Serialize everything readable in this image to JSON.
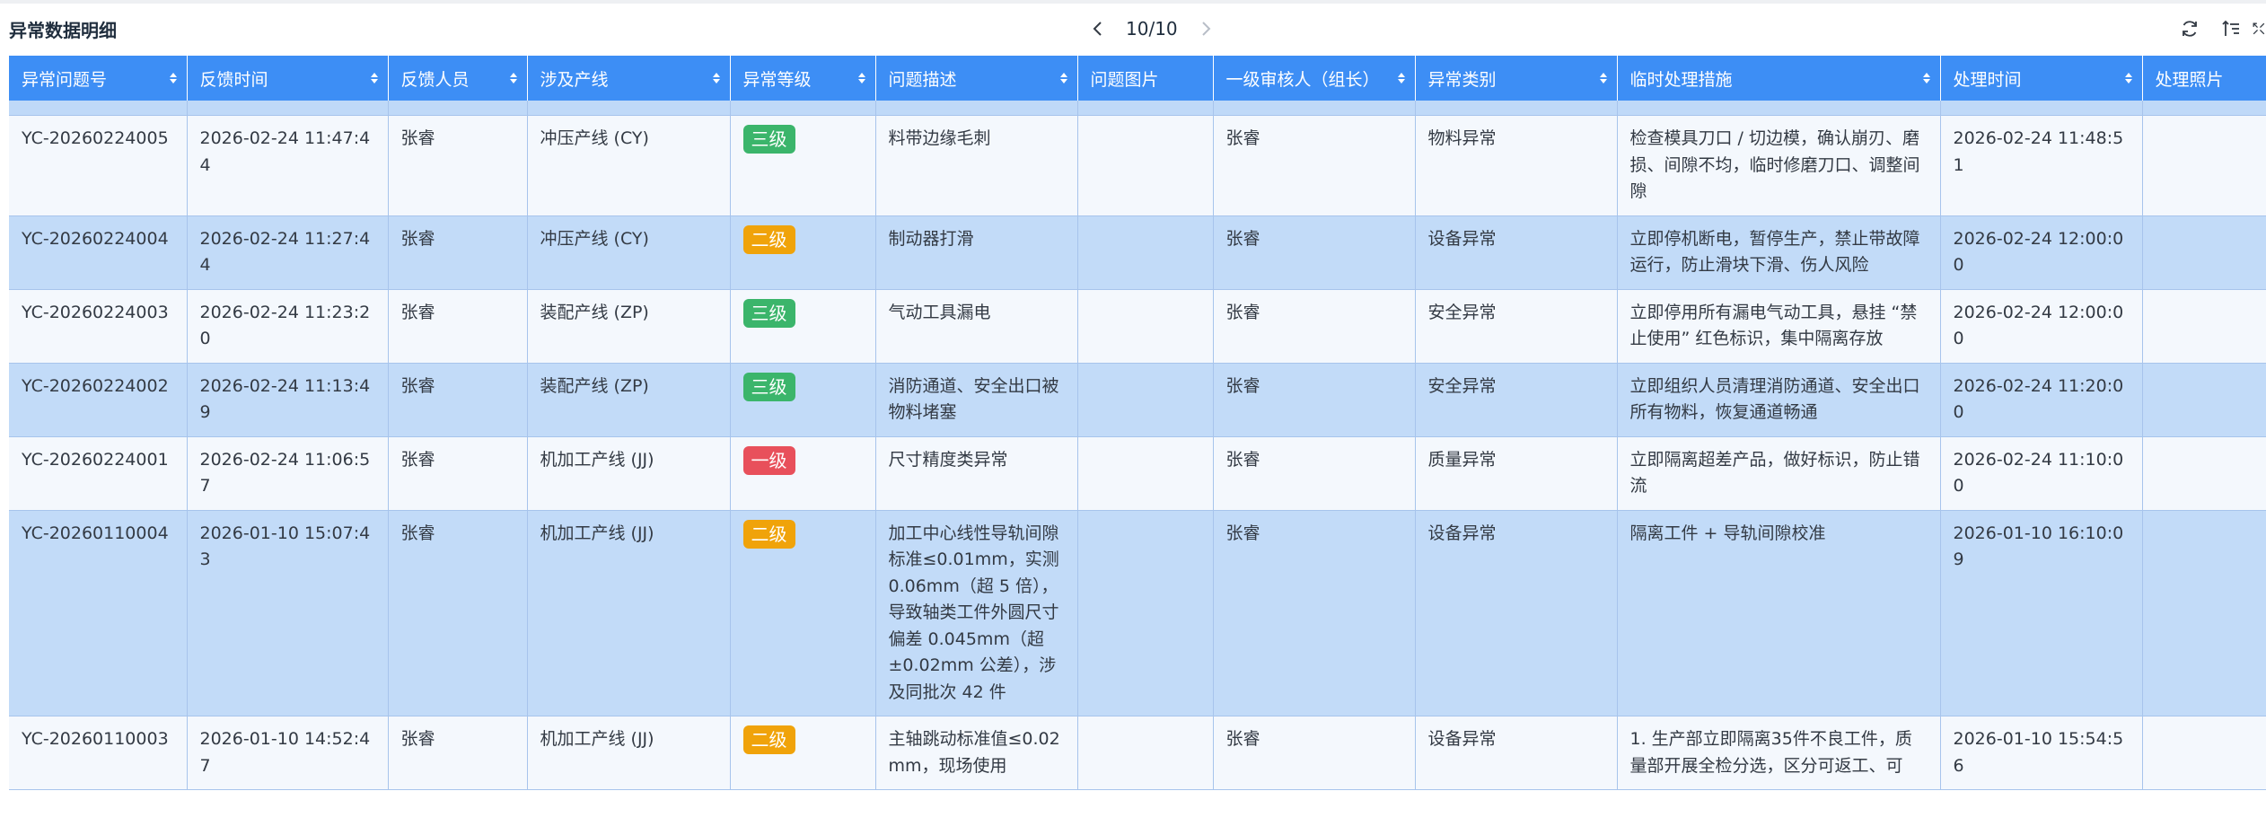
{
  "header": {
    "title": "异常数据明细",
    "pager_text": "10/10",
    "prev_icon": "chevron-left-icon",
    "next_icon": "chevron-right-icon",
    "tools": [
      "refresh-icon",
      "column-settings-icon",
      "fullscreen-icon"
    ]
  },
  "table": {
    "columns": [
      "异常问题号",
      "反馈时间",
      "反馈人员",
      "涉及产线",
      "异常等级",
      "问题描述",
      "问题图片",
      "一级审核人（组长）",
      "异常类别",
      "临时处理措施",
      "处理时间",
      "处理照片"
    ],
    "level_colors": {
      "三级": "#3bb56b",
      "二级": "#f0a30a",
      "一级": "#e8505b"
    },
    "rows": [
      {
        "id": "YC-20260224005",
        "time": "2026-02-24 11:47:44",
        "reporter": "张睿",
        "line": "冲压产线 (CY)",
        "level": "三级",
        "desc": "料带边缘毛刺",
        "image": "",
        "auditor": "张睿",
        "category": "物料异常",
        "measure": "检查模具刀口 / 切边模，确认崩刃、磨损、间隙不均，临时修磨刀口、调整间隙",
        "handle_time": "2026-02-24 11:48:51",
        "photo": ""
      },
      {
        "id": "YC-20260224004",
        "time": "2026-02-24 11:27:44",
        "reporter": "张睿",
        "line": "冲压产线 (CY)",
        "level": "二级",
        "desc": "制动器打滑",
        "image": "",
        "auditor": "张睿",
        "category": "设备异常",
        "measure": "立即停机断电，暂停生产，禁止带故障运行，防止滑块下滑、伤人风险",
        "handle_time": "2026-02-24 12:00:00",
        "photo": ""
      },
      {
        "id": "YC-20260224003",
        "time": "2026-02-24 11:23:20",
        "reporter": "张睿",
        "line": "装配产线 (ZP)",
        "level": "三级",
        "desc": "气动工具漏电",
        "image": "",
        "auditor": "张睿",
        "category": "安全异常",
        "measure": "立即停用所有漏电气动工具，悬挂 “禁止使用” 红色标识，集中隔离存放",
        "handle_time": "2026-02-24 12:00:00",
        "photo": ""
      },
      {
        "id": "YC-20260224002",
        "time": "2026-02-24 11:13:49",
        "reporter": "张睿",
        "line": "装配产线 (ZP)",
        "level": "三级",
        "desc": "消防通道、安全出口被物料堵塞",
        "image": "",
        "auditor": "张睿",
        "category": "安全异常",
        "measure": "立即组织人员清理消防通道、安全出口所有物料，恢复通道畅通",
        "handle_time": "2026-02-24 11:20:00",
        "photo": ""
      },
      {
        "id": "YC-20260224001",
        "time": "2026-02-24 11:06:57",
        "reporter": "张睿",
        "line": "机加工产线 (JJ)",
        "level": "一级",
        "desc": "尺寸精度类异常",
        "image": "",
        "auditor": "张睿",
        "category": "质量异常",
        "measure": "立即隔离超差产品，做好标识，防止错流",
        "handle_time": "2026-02-24 11:10:00",
        "photo": ""
      },
      {
        "id": "YC-20260110004",
        "time": "2026-01-10 15:07:43",
        "reporter": "张睿",
        "line": "机加工产线 (JJ)",
        "level": "二级",
        "desc": "加工中心线性导轨间隙标准≤0.01mm，实测 0.06mm（超 5 倍），导致轴类工件外圆尺寸偏差 0.045mm（超 ±0.02mm 公差），涉及同批次 42 件",
        "image": "",
        "auditor": "张睿",
        "category": "设备异常",
        "measure": "隔离工件 + 导轨间隙校准",
        "handle_time": "2026-01-10 16:10:09",
        "photo": ""
      },
      {
        "id": "YC-20260110003",
        "time": "2026-01-10 14:52:47",
        "reporter": "张睿",
        "line": "机加工产线 (JJ)",
        "level": "二级",
        "desc": "主轴跳动标准值≤0.02mm，现场使用",
        "image": "",
        "auditor": "张睿",
        "category": "设备异常",
        "measure": "1. 生产部立即隔离35件不良工件，质量部开展全检分选，区分可返工、可",
        "handle_time": "2026-01-10 15:54:56",
        "photo": ""
      }
    ]
  }
}
